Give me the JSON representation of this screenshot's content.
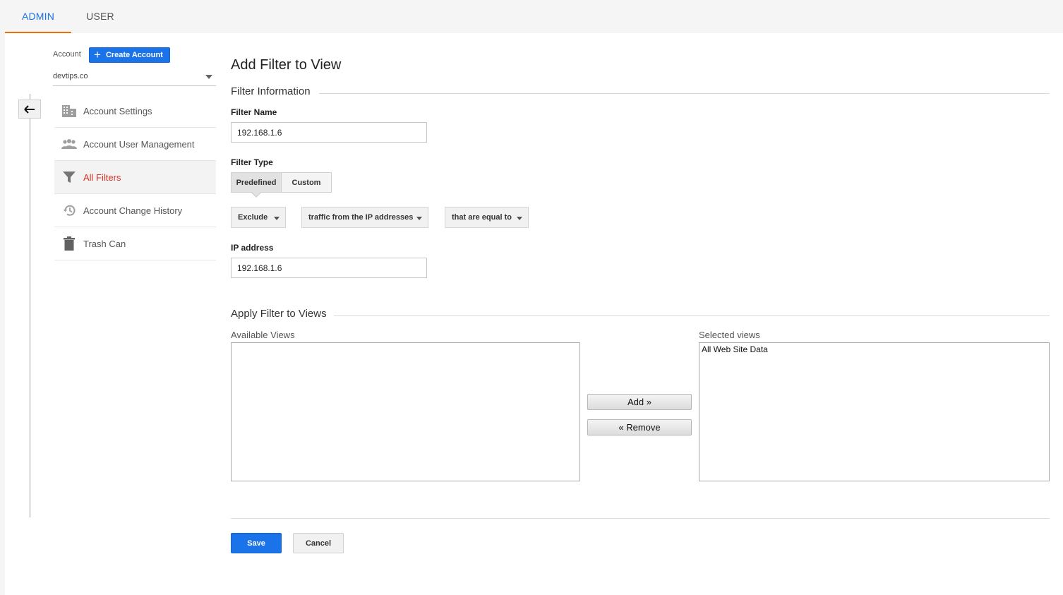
{
  "tabs": {
    "admin": "ADMIN",
    "user": "USER"
  },
  "account": {
    "label": "Account",
    "create_label": "Create Account",
    "selected": "devtips.co"
  },
  "nav": {
    "items": [
      {
        "label": "Account Settings",
        "icon": "building-icon",
        "active": false
      },
      {
        "label": "Account User Management",
        "icon": "users-icon",
        "active": false
      },
      {
        "label": "All Filters",
        "icon": "filter-icon",
        "active": true
      },
      {
        "label": "Account Change History",
        "icon": "history-icon",
        "active": false
      },
      {
        "label": "Trash Can",
        "icon": "trash-icon",
        "active": false
      }
    ]
  },
  "main": {
    "title": "Add Filter to View",
    "filter_info_title": "Filter Information",
    "filter_name_label": "Filter Name",
    "filter_name_value": "192.168.1.6",
    "filter_type_label": "Filter Type",
    "type_predefined": "Predefined",
    "type_custom": "Custom",
    "type_selected": "Predefined",
    "dropdowns": {
      "action": "Exclude",
      "source": "traffic from the IP addresses",
      "operator": "that are equal to"
    },
    "ip_label": "IP address",
    "ip_value": "192.168.1.6",
    "apply_title": "Apply Filter to Views",
    "available_label": "Available Views",
    "available_views": [],
    "selected_label": "Selected views",
    "selected_views": [
      "All Web Site Data"
    ],
    "add_label": "Add »",
    "remove_label": "« Remove",
    "save_label": "Save",
    "cancel_label": "Cancel"
  },
  "colors": {
    "accent_blue": "#1a73e8",
    "active_red": "#d93025",
    "tab_underline": "#e8710a"
  }
}
